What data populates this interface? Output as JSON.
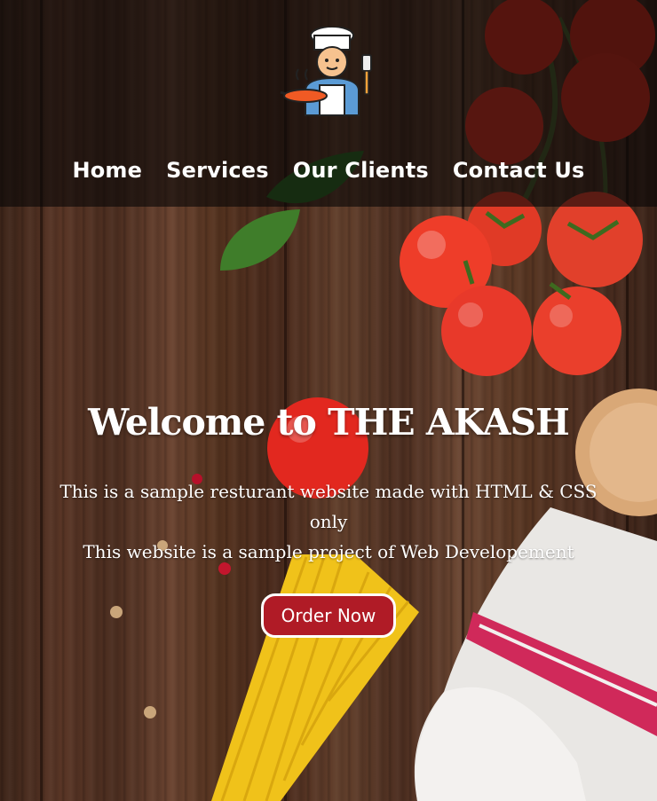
{
  "header": {
    "logo": {
      "icon": "chef-cooking-icon",
      "alt": "chef logo"
    },
    "nav": [
      {
        "label": "Home"
      },
      {
        "label": "Services"
      },
      {
        "label": "Our Clients"
      },
      {
        "label": "Contact Us"
      }
    ]
  },
  "hero": {
    "title": "Welcome to THE AKASH",
    "line1": "This is a sample resturant website made with HTML & CSS only",
    "line2": "This website is a sample project of Web Developement",
    "cta_label": "Order Now"
  },
  "colors": {
    "header_overlay": "#0a0707",
    "button_bg": "#b01b26",
    "text": "#ffffff"
  }
}
